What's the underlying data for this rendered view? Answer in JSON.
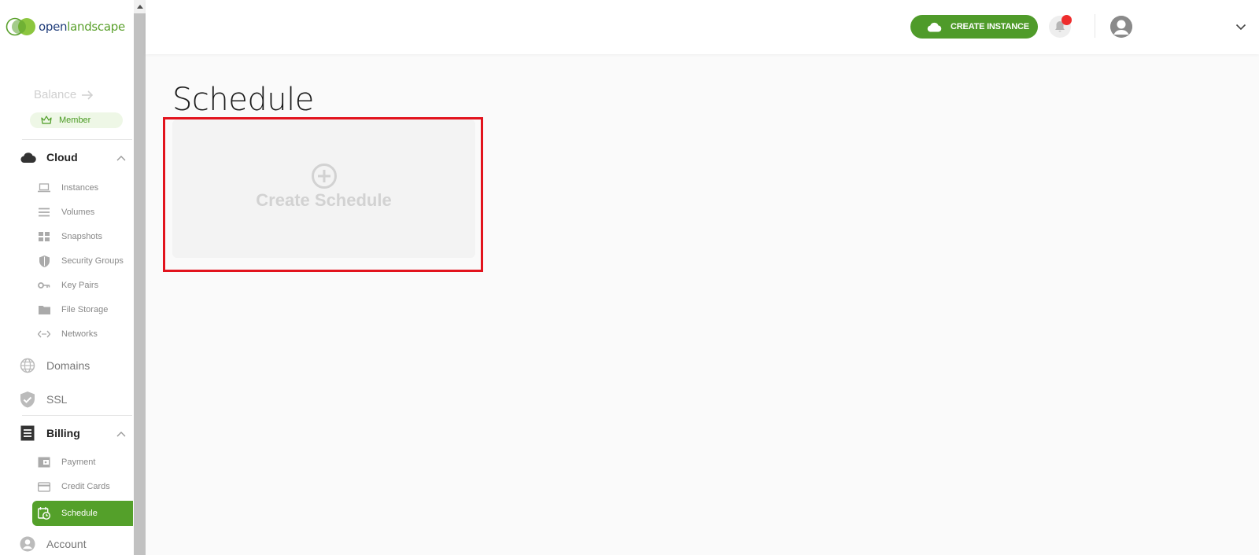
{
  "brand": {
    "name_part1": "open",
    "name_part2": "landscape"
  },
  "sidebar": {
    "balance_label": "Balance",
    "member_label": "Member",
    "sections": {
      "cloud": {
        "label": "Cloud",
        "icon": "cloud-icon"
      },
      "domains": {
        "label": "Domains",
        "icon": "globe-icon"
      },
      "ssl": {
        "label": "SSL",
        "icon": "shield-check-icon"
      },
      "billing": {
        "label": "Billing",
        "icon": "receipt-icon"
      },
      "account": {
        "label": "Account",
        "icon": "account-icon"
      }
    },
    "cloud_items": [
      {
        "label": "Instances",
        "icon": "laptop-icon"
      },
      {
        "label": "Volumes",
        "icon": "list-icon"
      },
      {
        "label": "Snapshots",
        "icon": "grid-icon"
      },
      {
        "label": "Security Groups",
        "icon": "shield-icon"
      },
      {
        "label": "Key Pairs",
        "icon": "key-icon"
      },
      {
        "label": "File Storage",
        "icon": "folder-icon"
      },
      {
        "label": "Networks",
        "icon": "code-icon"
      }
    ],
    "billing_items": [
      {
        "label": "Payment",
        "icon": "wallet-icon"
      },
      {
        "label": "Credit Cards",
        "icon": "credit-card-icon"
      },
      {
        "label": "Schedule",
        "icon": "calendar-clock-icon",
        "active": true
      }
    ]
  },
  "header": {
    "create_instance_label": "CREATE INSTANCE",
    "has_notification": true
  },
  "main": {
    "page_title": "Schedule",
    "create_card_label": "Create Schedule"
  },
  "colors": {
    "accent": "#54a02a",
    "highlight": "#e2131d",
    "notification": "#ee2d2d"
  }
}
